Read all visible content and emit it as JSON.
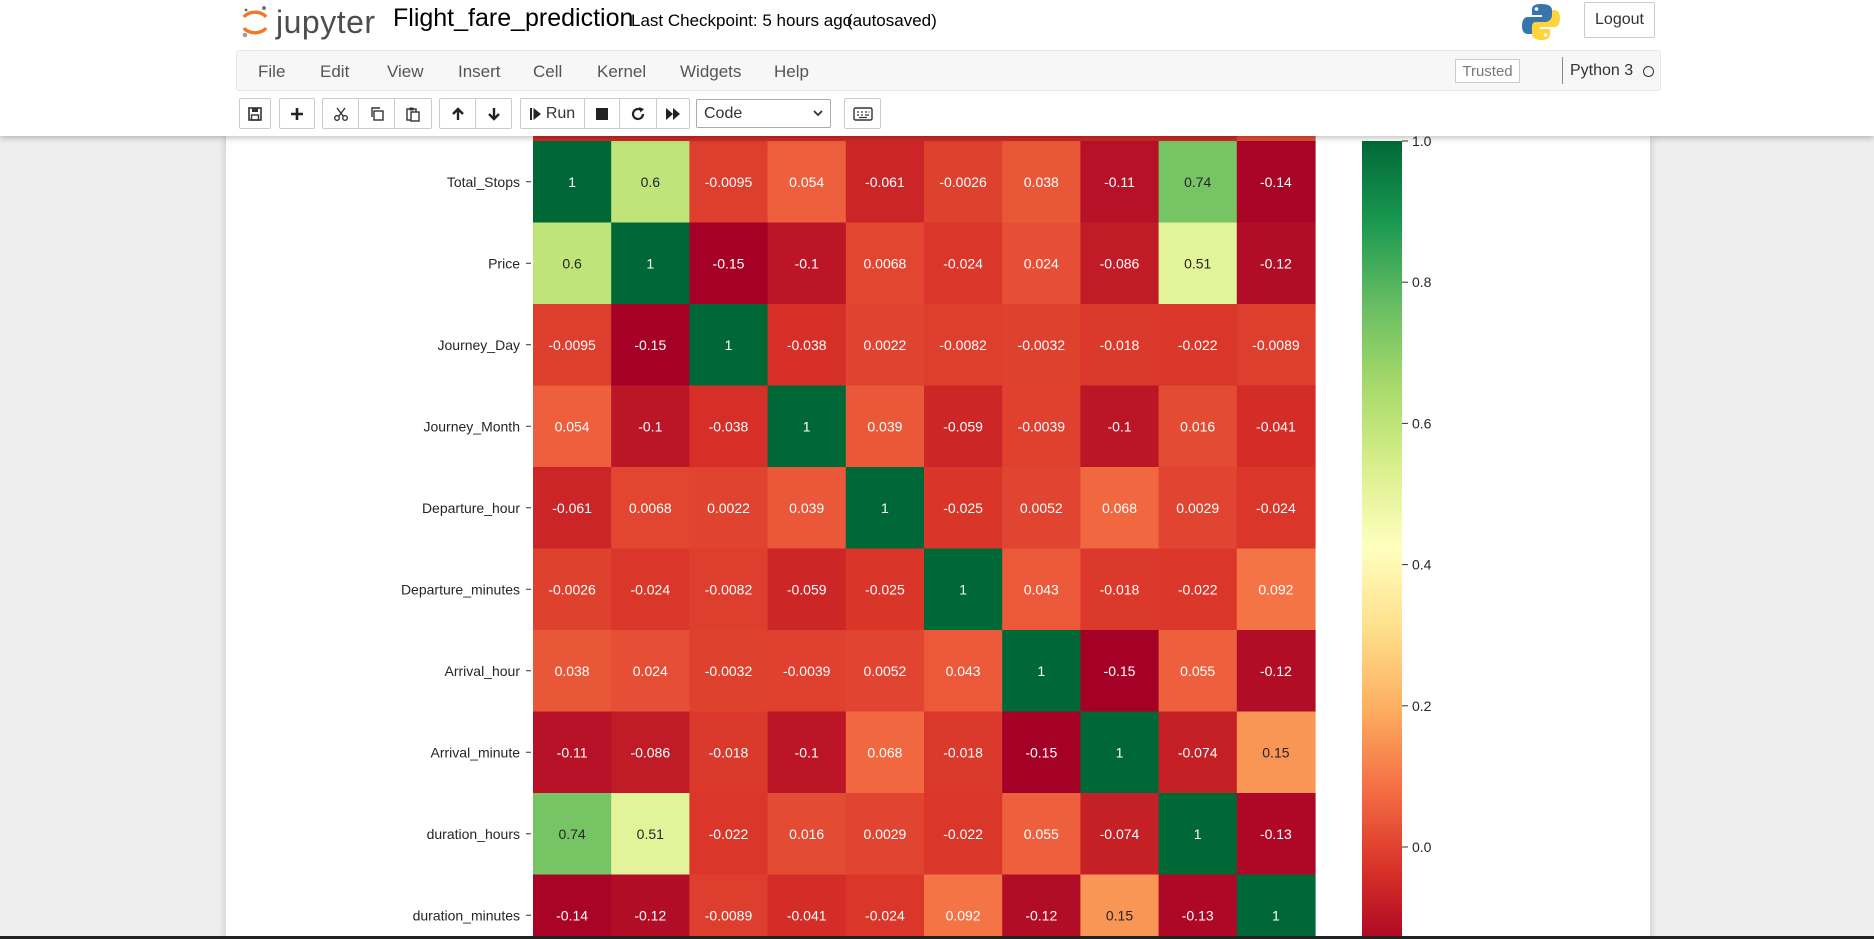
{
  "header": {
    "logo_text": "jupyter",
    "notebook_title": "Flight_fare_prediction",
    "checkpoint": "Last Checkpoint: 5 hours ago",
    "autosave": "(autosaved)",
    "logout_label": "Logout"
  },
  "menu": {
    "items": [
      "File",
      "Edit",
      "View",
      "Insert",
      "Cell",
      "Kernel",
      "Widgets",
      "Help"
    ],
    "trusted_label": "Trusted",
    "kernel_name": "Python 3"
  },
  "toolbar": {
    "run_label": "Run",
    "cell_type": "Code",
    "icons": [
      "save-icon",
      "add-cell-icon",
      "cut-icon",
      "copy-icon",
      "paste-icon",
      "move-up-icon",
      "move-down-icon",
      "run-icon",
      "stop-icon",
      "restart-icon",
      "fast-forward-icon",
      "keyboard-icon"
    ]
  },
  "chart_data": {
    "type": "heatmap",
    "colormap": "RdYlGn",
    "visible_rows": [
      "Total_Stops",
      "Price",
      "Journey_Day",
      "Journey_Month",
      "Departure_hour",
      "Departure_minutes",
      "Arrival_hour",
      "Arrival_minute",
      "duration_hours",
      "duration_minutes"
    ],
    "values": [
      [
        "1",
        "0.6",
        "-0.0095",
        "0.054",
        "-0.061",
        "-0.0026",
        "0.038",
        "-0.11",
        "0.74",
        "-0.14"
      ],
      [
        "0.6",
        "1",
        "-0.15",
        "-0.1",
        "0.0068",
        "-0.024",
        "0.024",
        "-0.086",
        "0.51",
        "-0.12"
      ],
      [
        "-0.0095",
        "-0.15",
        "1",
        "-0.038",
        "0.0022",
        "-0.0082",
        "-0.0032",
        "-0.018",
        "-0.022",
        "-0.0089"
      ],
      [
        "0.054",
        "-0.1",
        "-0.038",
        "1",
        "0.039",
        "-0.059",
        "-0.0039",
        "-0.1",
        "0.016",
        "-0.041"
      ],
      [
        "-0.061",
        "0.0068",
        "0.0022",
        "0.039",
        "1",
        "-0.025",
        "0.0052",
        "0.068",
        "0.0029",
        "-0.024"
      ],
      [
        "-0.0026",
        "-0.024",
        "-0.0082",
        "-0.059",
        "-0.025",
        "1",
        "0.043",
        "-0.018",
        "-0.022",
        "0.092"
      ],
      [
        "0.038",
        "0.024",
        "-0.0032",
        "-0.0039",
        "0.0052",
        "0.043",
        "1",
        "-0.15",
        "0.055",
        "-0.12"
      ],
      [
        "-0.11",
        "-0.086",
        "-0.018",
        "-0.1",
        "0.068",
        "-0.018",
        "-0.15",
        "1",
        "-0.074",
        "0.15"
      ],
      [
        "0.74",
        "0.51",
        "-0.022",
        "0.016",
        "0.0029",
        "-0.022",
        "0.055",
        "-0.074",
        "1",
        "-0.13"
      ],
      [
        "-0.14",
        "-0.12",
        "-0.0089",
        "-0.041",
        "-0.024",
        "0.092",
        "-0.12",
        "0.15",
        "-0.13",
        "1"
      ]
    ],
    "colorbar": {
      "ticks": [
        "1.0",
        "0.8",
        "0.6",
        "0.4",
        "0.2",
        "0.0"
      ],
      "range": [
        -0.15,
        1.0
      ]
    }
  }
}
